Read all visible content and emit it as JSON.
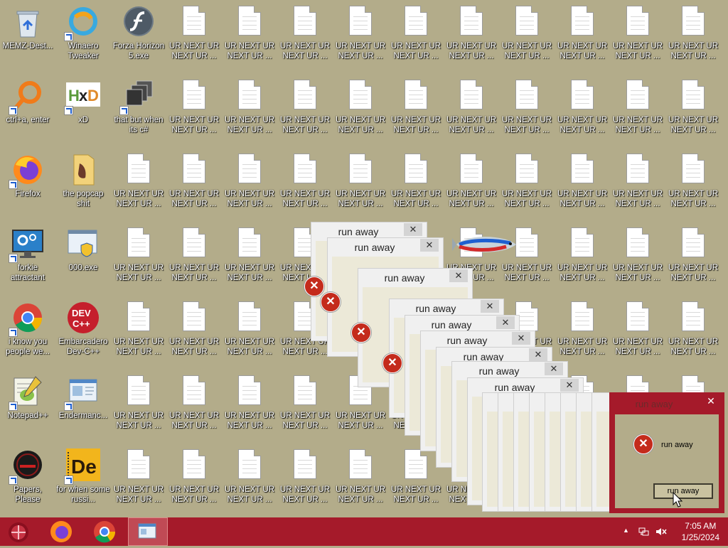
{
  "desktop": {
    "icons": [
      {
        "label": "MEMZ-Dest...",
        "type": "recycle"
      },
      {
        "label": "Winaero Tweaker",
        "type": "winaero"
      },
      {
        "label": "Forza Horizon 5.exe",
        "type": "flash"
      },
      {
        "label": "ctrl+a, enter",
        "type": "magnifier"
      },
      {
        "label": "xD",
        "type": "hxd"
      },
      {
        "label": "that but when its c#",
        "type": "stack"
      },
      {
        "label": "Firefox",
        "type": "firefox"
      },
      {
        "label": "the popcap shit",
        "type": "folder"
      },
      {
        "label": "forkie attractant",
        "type": "monitor"
      },
      {
        "label": "000.exe",
        "type": "shield-window"
      },
      {
        "label": "i know you people we...",
        "type": "chrome"
      },
      {
        "label": "Embarcadero Dev-C++",
        "type": "devcpp"
      },
      {
        "label": "Notepad++",
        "type": "notepadpp"
      },
      {
        "label": "Endermanc...",
        "type": "window"
      },
      {
        "label": "Papers, Please",
        "type": "papers"
      },
      {
        "label": "for when some russi...",
        "type": "de"
      }
    ],
    "file_label": "UR NEXT UR NEXT UR ...",
    "partial_file_label": "NE"
  },
  "dialogs": {
    "title": "run away",
    "close": "✕",
    "error_glyph": "✕"
  },
  "active_dialog": {
    "title": "run away",
    "message": "run away",
    "button": "run away",
    "close": "✕"
  },
  "taskbar": {
    "time": "7:05 AM",
    "date": "1/25/2024",
    "tray_arrow": "▲"
  },
  "colors": {
    "desktop": "#b3ac8a",
    "taskbar": "#a51a2a",
    "error": "#c42b1c"
  }
}
